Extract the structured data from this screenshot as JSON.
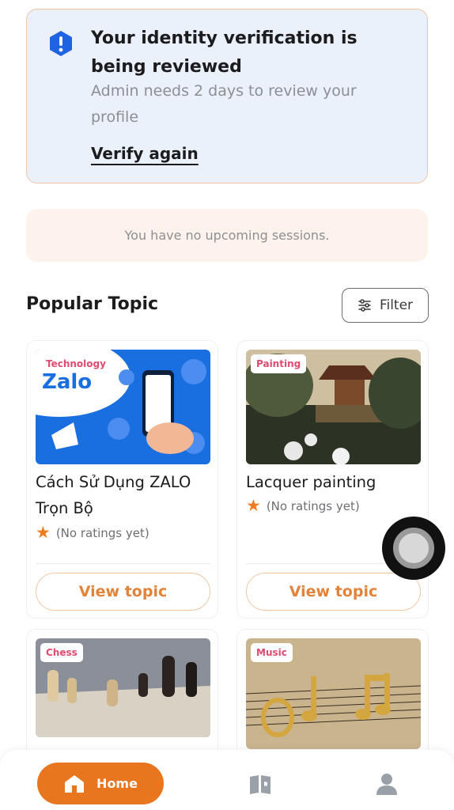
{
  "verification": {
    "title": "Your identity verification is being reviewed",
    "description": "Admin needs 2 days to review your profile",
    "link_label": "Verify again",
    "icon": "alert-shield-icon"
  },
  "sessions": {
    "empty_message": "You have no upcoming sessions."
  },
  "popular": {
    "title": "Popular Topic",
    "filter_label": "Filter",
    "topics": [
      {
        "category": "Technology",
        "name": "Cách Sử Dụng ZALO Trọn Bộ",
        "rating_text": "(No ratings yet)",
        "button_label": "View topic",
        "image_brand": "Zalo"
      },
      {
        "category": "Painting",
        "name": "Lacquer painting",
        "rating_text": "(No ratings yet)",
        "button_label": "View topic"
      },
      {
        "category": "Chess"
      },
      {
        "category": "Music"
      }
    ]
  },
  "nav": {
    "items": [
      {
        "label": "Home",
        "icon": "home-icon",
        "active": true
      },
      {
        "label": "",
        "icon": "book-icon",
        "active": false
      },
      {
        "label": "",
        "icon": "profile-icon",
        "active": false
      }
    ]
  },
  "colors": {
    "accent": "#e8761f",
    "badge_text": "#e04b6f",
    "verify_bg": "#eaf1fb",
    "verify_icon": "#1f63e3",
    "sessions_bg": "#fdf3ec"
  }
}
